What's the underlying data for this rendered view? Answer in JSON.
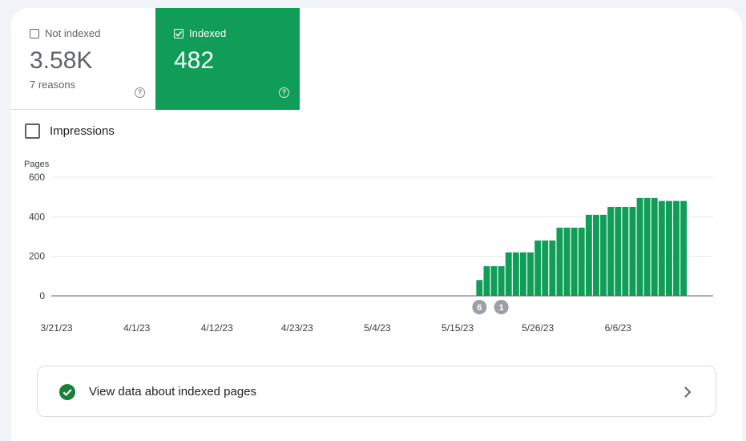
{
  "tiles": {
    "not_indexed": {
      "label": "Not indexed",
      "value": "3.58K",
      "sub": "7 reasons",
      "checked": false
    },
    "indexed": {
      "label": "Indexed",
      "value": "482",
      "checked": true
    }
  },
  "impressions_label": "Impressions",
  "chart_data": {
    "type": "bar",
    "ylabel": "Pages",
    "ylim": [
      0,
      600
    ],
    "yticks": [
      600,
      400,
      200,
      0
    ],
    "x_tick_labels": [
      "3/21/23",
      "4/1/23",
      "4/12/23",
      "4/23/23",
      "5/4/23",
      "5/15/23",
      "5/26/23",
      "6/6/23"
    ],
    "start_date": "3/21/23",
    "first_bar_date": "5/18/23",
    "values": [
      80,
      150,
      150,
      150,
      220,
      220,
      220,
      220,
      280,
      280,
      280,
      345,
      345,
      345,
      345,
      410,
      410,
      410,
      450,
      450,
      450,
      450,
      495,
      495,
      495,
      480,
      480,
      480,
      480
    ],
    "color": "#0f9d58",
    "annotations": [
      {
        "label": "6",
        "date": "5/18/23"
      },
      {
        "label": "1",
        "date": "5/21/23"
      }
    ]
  },
  "link": {
    "label": "View data about indexed pages"
  },
  "colors": {
    "accent": "#0f9d58",
    "ok": "#188038"
  }
}
